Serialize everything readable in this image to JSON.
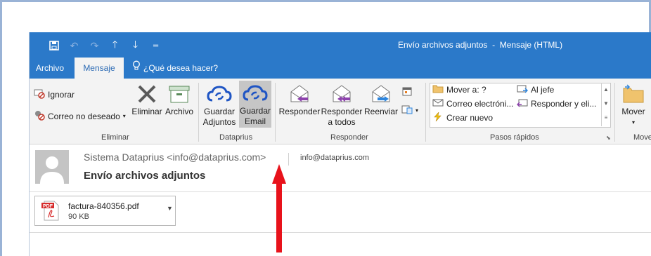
{
  "window": {
    "title": "Envío archivos adjuntos  -  Mensaje (HTML)"
  },
  "qat": {
    "icons": [
      "save-icon",
      "undo-icon",
      "redo-icon",
      "up-arrow-icon",
      "down-arrow-icon",
      "customize-icon"
    ]
  },
  "tabs": {
    "archivo": "Archivo",
    "mensaje": "Mensaje",
    "tell_me": "¿Qué desea hacer?"
  },
  "ribbon": {
    "eliminar": {
      "ignorar": "Ignorar",
      "correo_no_deseado": "Correo no deseado",
      "eliminar": "Eliminar",
      "archivo": "Archivo",
      "label": "Eliminar"
    },
    "dataprius": {
      "guardar_adjuntos_1": "Guardar",
      "guardar_adjuntos_2": "Adjuntos",
      "guardar_email_1": "Guardar",
      "guardar_email_2": "Email",
      "label": "Dataprius"
    },
    "responder": {
      "responder": "Responder",
      "responder_todos_1": "Responder",
      "responder_todos_2": "a todos",
      "reenviar": "Reenviar",
      "label": "Responder"
    },
    "pasos_rapidos": {
      "mover_a": "Mover a: ?",
      "al_jefe": "Al jefe",
      "correo_electronico": "Correo electróni...",
      "responder_y_eliminar": "Responder y eli...",
      "crear_nuevo": "Crear nuevo",
      "label": "Pasos rápidos"
    },
    "mover": {
      "mover": "Mover",
      "label": "Move"
    }
  },
  "message": {
    "sender": "Sistema Dataprius <info@dataprius.com>",
    "to": "info@dataprius.com",
    "subject": "Envío archivos adjuntos"
  },
  "attachment": {
    "name": "factura-840356.pdf",
    "size": "90 KB",
    "badge": "PDF"
  },
  "colors": {
    "title_bar": "#2b79c9",
    "ribbon": "#f3f3f3",
    "cloud": "#1f55c4",
    "annotation_arrow": "#e8121b"
  }
}
